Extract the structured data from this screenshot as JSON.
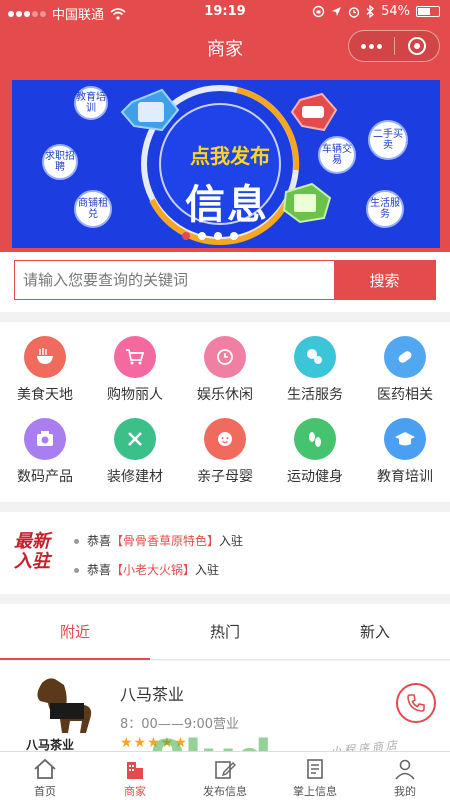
{
  "status_bar": {
    "carrier": "中国联通",
    "time": "19:19",
    "battery": "54%"
  },
  "nav": {
    "title": "商家",
    "more_icon": "more-dots-icon",
    "close_icon": "target-icon"
  },
  "banner": {
    "headline": "点我发布",
    "big_text": "信息",
    "bubbles": [
      "教育培训",
      "求职招聘",
      "商铺租兑",
      "车辆交易",
      "二手买卖",
      "生活服务"
    ],
    "pages": 4,
    "active_page": 0,
    "colors": {
      "background": "#1c3ee0",
      "headline": "#ffd61e"
    }
  },
  "search": {
    "placeholder": "请输入您要查询的关键词",
    "button": "搜索"
  },
  "categories": [
    {
      "label": "美食天地",
      "icon": "noodle-bowl-icon",
      "color": "#f06a5e"
    },
    {
      "label": "购物丽人",
      "icon": "shopping-cart-icon",
      "color": "#f46aa0"
    },
    {
      "label": "娱乐休闲",
      "icon": "clock-icon",
      "color": "#f07fa4"
    },
    {
      "label": "生活服务",
      "icon": "bubbles-icon",
      "color": "#3cc4d8"
    },
    {
      "label": "医药相关",
      "icon": "pill-icon",
      "color": "#52a8f0"
    },
    {
      "label": "数码产品",
      "icon": "camera-icon",
      "color": "#a97ef0"
    },
    {
      "label": "装修建材",
      "icon": "tools-icon",
      "color": "#3cc08a"
    },
    {
      "label": "亲子母婴",
      "icon": "baby-icon",
      "color": "#f06a5e"
    },
    {
      "label": "运动健身",
      "icon": "footprints-icon",
      "color": "#46c36e"
    },
    {
      "label": "教育培训",
      "icon": "graduation-cap-icon",
      "color": "#4a9ff0"
    }
  ],
  "news": {
    "logo_line1": "最新",
    "logo_line2": "入驻",
    "items": [
      {
        "prefix": "恭喜",
        "name": "【骨骨香草原特色】",
        "suffix": "入驻"
      },
      {
        "prefix": "恭喜",
        "name": "【小老大火锅】",
        "suffix": "入驻"
      }
    ]
  },
  "tabs": [
    {
      "label": "附近",
      "active": true
    },
    {
      "label": "热门",
      "active": false
    },
    {
      "label": "新入",
      "active": false
    }
  ],
  "shop": {
    "name": "八马茶业",
    "hours": "8：00——9:00营业",
    "stars": "★★★★★",
    "phone_icon": "phone-icon"
  },
  "bottom_nav": [
    {
      "label": "首页",
      "icon": "home-icon",
      "active": false
    },
    {
      "label": "商家",
      "icon": "building-icon",
      "active": true
    },
    {
      "label": "发布信息",
      "icon": "edit-icon",
      "active": false
    },
    {
      "label": "掌上信息",
      "icon": "document-icon",
      "active": false
    },
    {
      "label": "我的",
      "icon": "user-icon",
      "active": false
    }
  ],
  "watermark": {
    "brand": "9lud",
    "domain": ".com",
    "subtitle": "小程序商店"
  },
  "accent_color": "#e34b4d"
}
